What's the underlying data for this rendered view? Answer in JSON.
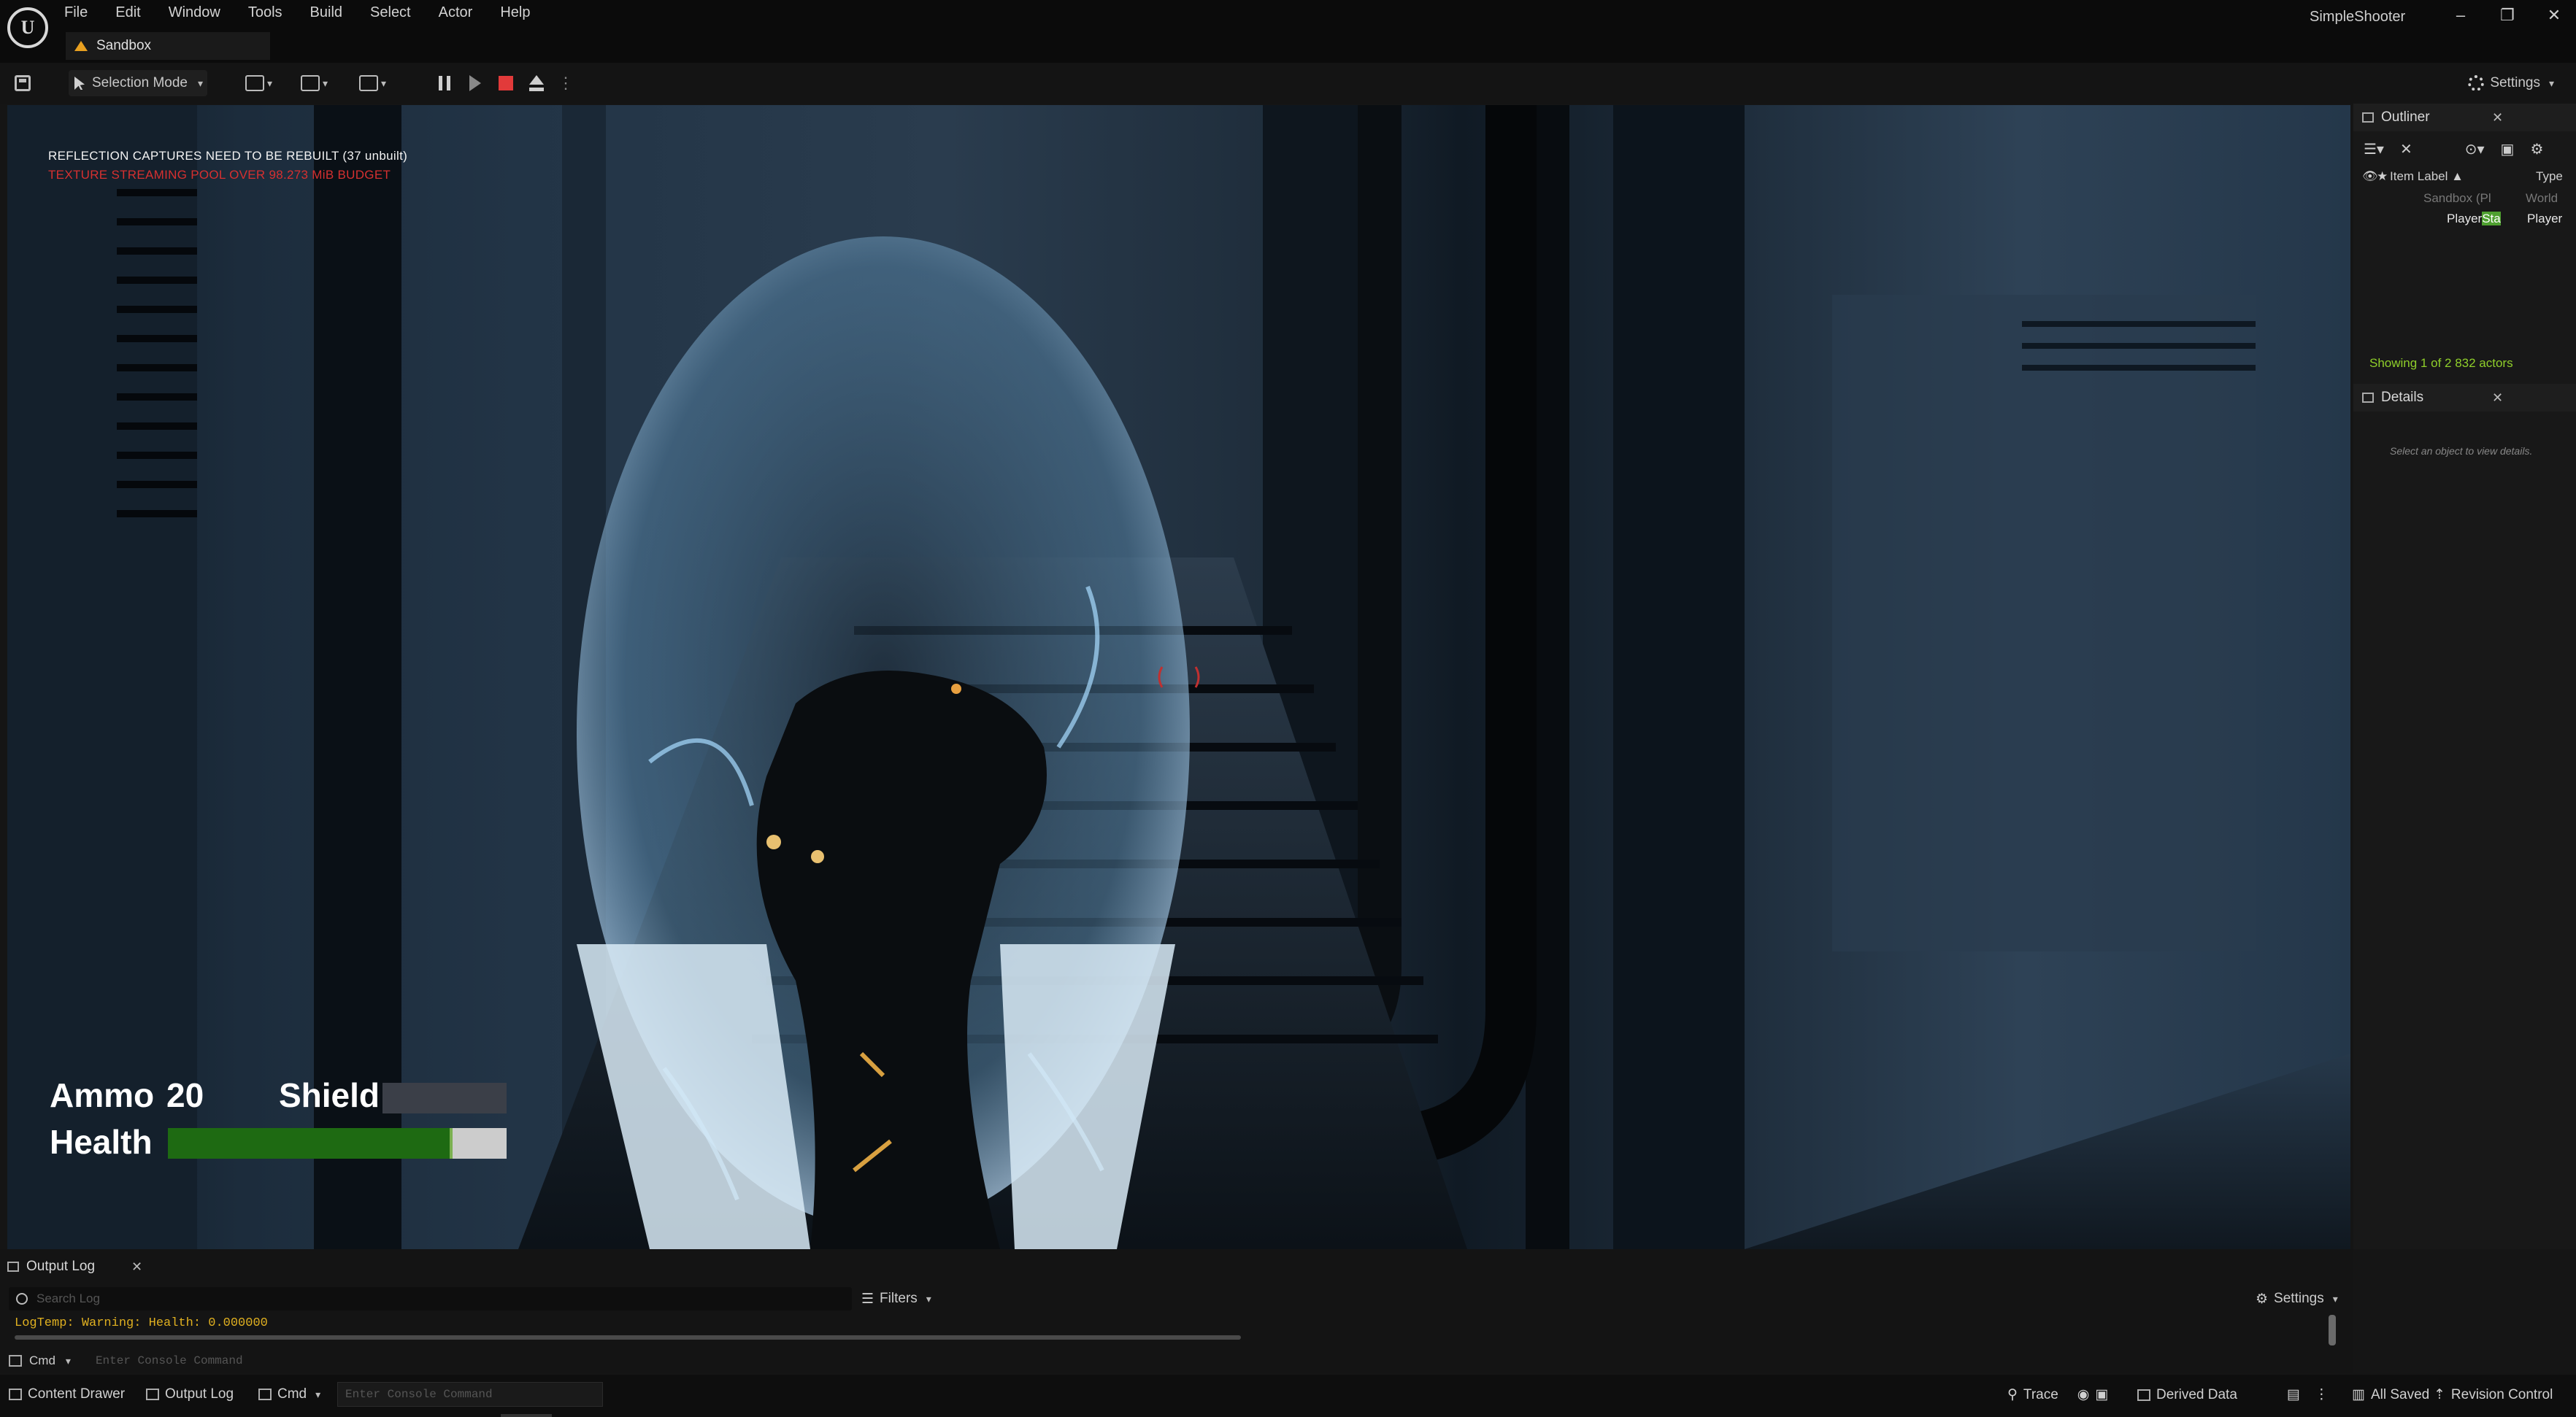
{
  "menu": {
    "items": [
      "File",
      "Edit",
      "Window",
      "Tools",
      "Build",
      "Select",
      "Actor",
      "Help"
    ]
  },
  "logo_text": "U",
  "level_tab": {
    "label": "Sandbox"
  },
  "project_name": "SimpleShooter",
  "window_controls": {
    "minimize": "–",
    "restore": "❐",
    "close": "✕"
  },
  "toolbar": {
    "mode_label": "Selection Mode",
    "settings_label": "Settings"
  },
  "viewport": {
    "warning_1": "REFLECTION CAPTURES NEED TO BE REBUILT (37 unbuilt)",
    "warning_2": "TEXTURE STREAMING POOL OVER 98.273 MiB BUDGET",
    "hud": {
      "ammo_label": "Ammo",
      "ammo_value": "20",
      "shield_label": "Shield",
      "shield_fraction": 0.0,
      "health_label": "Health",
      "health_fraction": 0.84
    }
  },
  "outliner": {
    "title": "Outliner",
    "col_label": "Item Label ▲",
    "col_type": "Type",
    "rows": [
      {
        "label": "Sandbox (Pl",
        "type": "World"
      },
      {
        "label_prefix": "Player",
        "label_highlight": "Sta",
        "type": "Player"
      }
    ],
    "count_text": "Showing 1 of 2 832 actors"
  },
  "details": {
    "title": "Details",
    "empty_text": "Select an object to view details."
  },
  "output_log": {
    "title": "Output Log",
    "search_placeholder": "Search Log",
    "filters_label": "Filters",
    "settings_label": "Settings",
    "lines": [
      "LogTemp: Warning: Health: 0.000000"
    ],
    "cmd_label": "Cmd",
    "console_placeholder": "Enter Console Command"
  },
  "statusbar": {
    "content_drawer": "Content Drawer",
    "output_log": "Output Log",
    "cmd": "Cmd",
    "console_placeholder": "Enter Console Command",
    "trace": "Trace",
    "derived_data": "Derived Data",
    "all_saved": "All Saved",
    "revision_control": "Revision Control"
  },
  "colors": {
    "health_fill": "#1e6a12",
    "shield_empty": "#3b3f48",
    "warning_red": "#d63030",
    "log_warning": "#e0b020",
    "outliner_count": "#8fcf2a",
    "stop_button": "#e23a3a"
  }
}
